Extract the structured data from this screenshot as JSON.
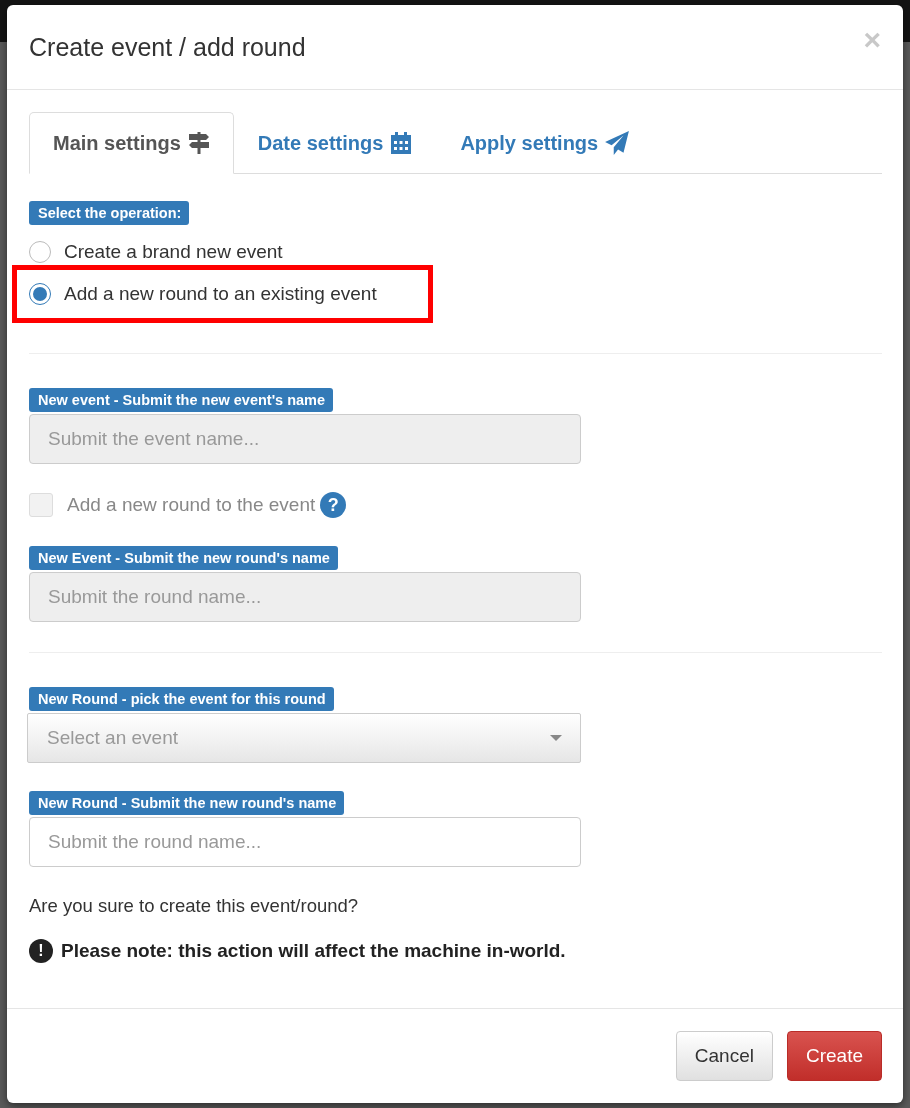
{
  "dialog": {
    "title": "Create event / add round",
    "close": "×"
  },
  "tabs": [
    {
      "label": "Main settings",
      "selected": true
    },
    {
      "label": "Date settings",
      "selected": false
    },
    {
      "label": "Apply settings",
      "selected": false
    }
  ],
  "operation": {
    "label": "Select the operation:",
    "options": [
      {
        "label": "Create a brand new event",
        "selected": false,
        "highlighted": false
      },
      {
        "label": "Add a new round to an existing event",
        "selected": true,
        "highlighted": true
      }
    ]
  },
  "sections": [
    {
      "fields": [
        {
          "kind": "input",
          "label": "New event - Submit the new event's name",
          "placeholder": "Submit the event name...",
          "disabled": true
        },
        {
          "kind": "checkbox",
          "label": "Add a new round to the event",
          "checked": false,
          "disabled": true,
          "help": "?"
        },
        {
          "kind": "input",
          "label": "New Event - Submit the new round's name",
          "placeholder": "Submit the round name...",
          "disabled": true
        }
      ]
    },
    {
      "fields": [
        {
          "kind": "select",
          "label": "New Round - pick the event for this round",
          "placeholder": "Select an event",
          "disabled": false
        },
        {
          "kind": "input",
          "label": "New Round - Submit the new round's name",
          "placeholder": "Submit the round name...",
          "disabled": false
        }
      ]
    }
  ],
  "confirm": "Are you sure to create this event/round?",
  "note": {
    "icon": "!",
    "text": "Please note: this action will affect the machine in-world."
  },
  "buttons": [
    {
      "label": "Cancel",
      "kind": "default"
    },
    {
      "label": "Create",
      "kind": "danger"
    }
  ]
}
